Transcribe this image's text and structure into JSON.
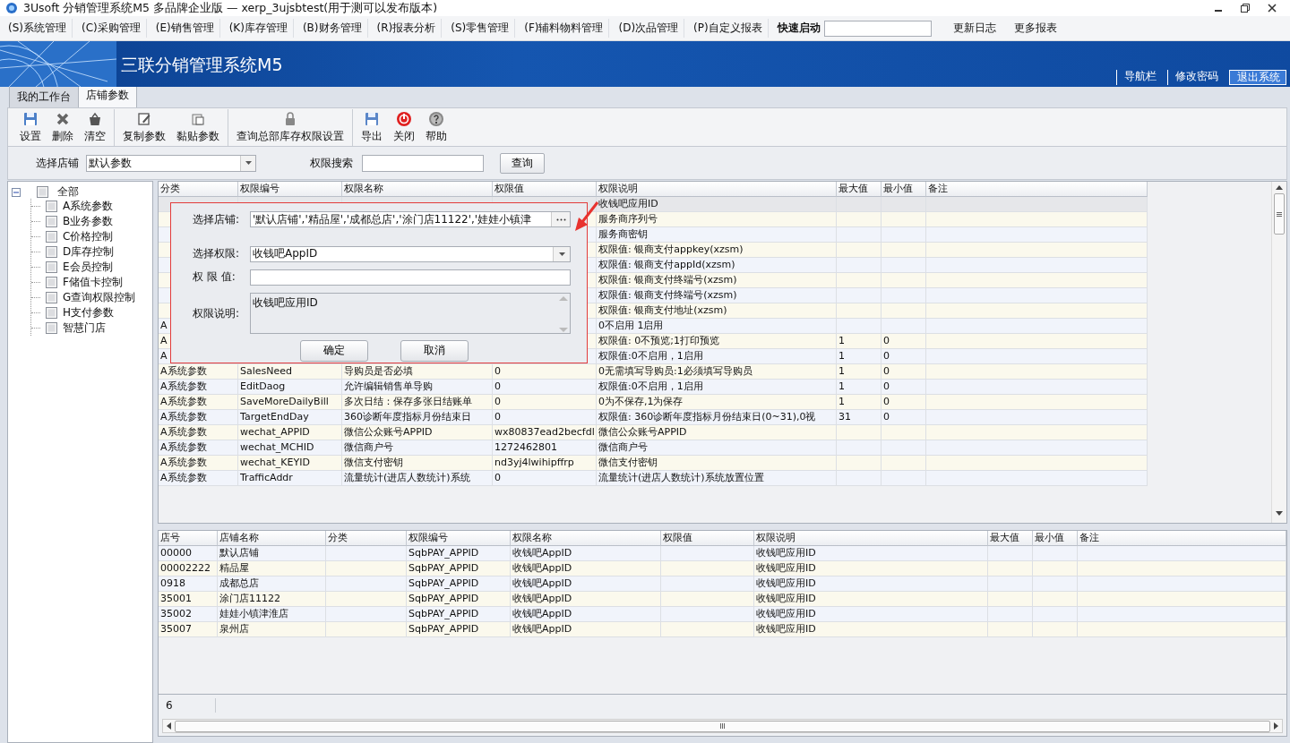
{
  "window": {
    "title": "3Usoft 分销管理系统M5 多品牌企业版 — xerp_3ujsbtest(用于测可以发布版本)"
  },
  "menu": {
    "items": [
      {
        "label": "(S)系统管理"
      },
      {
        "label": "(C)采购管理"
      },
      {
        "label": "(E)销售管理"
      },
      {
        "label": "(K)库存管理"
      },
      {
        "label": "(B)财务管理"
      },
      {
        "label": "(R)报表分析"
      },
      {
        "label": "(S)零售管理"
      },
      {
        "label": "(F)辅料物料管理"
      },
      {
        "label": "(D)次品管理"
      },
      {
        "label": "(P)自定义报表"
      }
    ],
    "quick_launch": {
      "label": "快速启动"
    },
    "links": [
      {
        "label": "更新日志"
      },
      {
        "label": "更多报表"
      }
    ]
  },
  "banner": {
    "title": "三联分销管理系统M5",
    "links": [
      {
        "label": "导航栏",
        "selected": false
      },
      {
        "label": "修改密码",
        "selected": false
      },
      {
        "label": "退出系统",
        "selected": true
      }
    ]
  },
  "tabs": [
    {
      "label": "我的工作台",
      "selected": false
    },
    {
      "label": "店铺参数",
      "selected": true
    }
  ],
  "toolbar": [
    [
      {
        "label": "设置",
        "disabled": false
      },
      {
        "label": "删除",
        "disabled": false
      },
      {
        "label": "清空",
        "disabled": false
      }
    ],
    [
      {
        "label": "复制参数",
        "disabled": false
      },
      {
        "label": "黏贴参数",
        "disabled": false
      }
    ],
    [
      {
        "label": "查询总部库存权限设置",
        "disabled": false
      }
    ],
    [
      {
        "label": "导出",
        "disabled": false
      },
      {
        "label": "关闭",
        "disabled": false
      },
      {
        "label": "帮助",
        "disabled": false
      }
    ]
  ],
  "filter": {
    "store_label": "选择店铺",
    "store_value": "默认参数",
    "search_label": "权限搜索",
    "search_button": "查询"
  },
  "tree": {
    "label": "全部",
    "expanded": true,
    "checked": false,
    "children": [
      {
        "label": "A系统参数",
        "checked": false
      },
      {
        "label": "B业务参数",
        "checked": false
      },
      {
        "label": "C价格控制",
        "checked": false
      },
      {
        "label": "D库存控制",
        "checked": false
      },
      {
        "label": "E会员控制",
        "checked": false
      },
      {
        "label": "F储值卡控制",
        "checked": false
      },
      {
        "label": "G查询权限控制",
        "checked": false
      },
      {
        "label": "H支付参数",
        "checked": false
      },
      {
        "label": "智慧门店",
        "checked": false
      }
    ]
  },
  "top_grid": {
    "columns": [
      "分类",
      "权限编号",
      "权限名称",
      "权限值",
      "权限说明",
      "最大值",
      "最小值",
      "备注"
    ],
    "rows": [
      {
        "kind": "under_dialog",
        "selected": true,
        "cells": [
          "收钱吧应用ID"
        ]
      },
      {
        "kind": "under_dialog",
        "selected": false,
        "cells": [
          "服务商序列号"
        ]
      },
      {
        "kind": "under_dialog",
        "selected": false,
        "cells": [
          "服务商密钥"
        ]
      },
      {
        "kind": "under_dialog",
        "selected": false,
        "cells": [
          "权限值: 银商支付appkey(xzsm)"
        ]
      },
      {
        "kind": "under_dialog",
        "selected": false,
        "cells": [
          "权限值: 银商支付appId(xzsm)"
        ]
      },
      {
        "kind": "under_dialog",
        "selected": false,
        "cells": [
          "权限值: 银商支付终端号(xzsm)"
        ]
      },
      {
        "kind": "under_dialog",
        "selected": false,
        "cells": [
          "权限值: 银商支付终端号(xzsm)"
        ]
      },
      {
        "kind": "under_dialog",
        "selected": false,
        "cells": [
          "权限值: 银商支付地址(xzsm)"
        ]
      },
      {
        "kind": "edge",
        "selected": false,
        "cells": [
          "A",
          "0不启用 1启用"
        ]
      },
      {
        "kind": "edge",
        "selected": false,
        "cells": [
          "A",
          "权限值: 0不预览;1打印预览",
          "1",
          "0"
        ]
      },
      {
        "kind": "edge",
        "selected": false,
        "cells": [
          "A",
          "权限值:0不启用，1启用",
          "1",
          "0"
        ]
      },
      {
        "kind": "full",
        "selected": false,
        "cells": [
          "A系统参数",
          "SalesNeed",
          "导购员是否必填",
          "0",
          "0无需填写导购员:1必须填写导购员",
          "1",
          "0"
        ]
      },
      {
        "kind": "full",
        "selected": false,
        "cells": [
          "A系统参数",
          "EditDaog",
          "允许编辑销售单导购",
          "0",
          "权限值:0不启用，1启用",
          "1",
          "0"
        ]
      },
      {
        "kind": "full",
        "selected": false,
        "cells": [
          "A系统参数",
          "SaveMoreDailyBill",
          "多次日结：保存多张日结账单",
          "0",
          "0为不保存,1为保存",
          "1",
          "0"
        ]
      },
      {
        "kind": "full",
        "selected": false,
        "cells": [
          "A系统参数",
          "TargetEndDay",
          "360诊断年度指标月份结束日",
          "0",
          "权限值: 360诊断年度指标月份结束日(0~31),0视",
          "31",
          "0"
        ]
      },
      {
        "kind": "full",
        "selected": false,
        "cells": [
          "A系统参数",
          "wechat_APPID",
          "微信公众账号APPID",
          "wx80837ead2becfdl",
          "微信公众账号APPID"
        ]
      },
      {
        "kind": "full",
        "selected": false,
        "cells": [
          "A系统参数",
          "wechat_MCHID",
          "微信商户号",
          "1272462801",
          "微信商户号"
        ]
      },
      {
        "kind": "full",
        "selected": false,
        "cells": [
          "A系统参数",
          "wechat_KEYID",
          "微信支付密钥",
          "nd3yj4lwihipffrp",
          "微信支付密钥"
        ]
      },
      {
        "kind": "full",
        "selected": false,
        "cells": [
          "A系统参数",
          "TrafficAddr",
          "流量统计(进店人数统计)系统",
          "0",
          "流量统计(进店人数统计)系统放置位置"
        ]
      }
    ]
  },
  "bottom_grid": {
    "columns": [
      "店号",
      "店铺名称",
      "分类",
      "权限编号",
      "权限名称",
      "权限值",
      "权限说明",
      "最大值",
      "最小值",
      "备注"
    ],
    "rows": [
      {
        "kind": "full",
        "selected": false,
        "cells": [
          "00000",
          "默认店铺",
          "",
          "SqbPAY_APPID",
          "收钱吧AppID",
          "",
          "收钱吧应用ID"
        ]
      },
      {
        "kind": "full",
        "selected": false,
        "cells": [
          "00002222",
          "精品屋",
          "",
          "SqbPAY_APPID",
          "收钱吧AppID",
          "",
          "收钱吧应用ID"
        ]
      },
      {
        "kind": "full",
        "selected": false,
        "cells": [
          "0918",
          "成都总店",
          "",
          "SqbPAY_APPID",
          "收钱吧AppID",
          "",
          "收钱吧应用ID"
        ]
      },
      {
        "kind": "full",
        "selected": false,
        "cells": [
          "35001",
          "涂门店11122",
          "",
          "SqbPAY_APPID",
          "收钱吧AppID",
          "",
          "收钱吧应用ID"
        ]
      },
      {
        "kind": "full",
        "selected": false,
        "cells": [
          "35002",
          "娃娃小镇津淮店",
          "",
          "SqbPAY_APPID",
          "收钱吧AppID",
          "",
          "收钱吧应用ID"
        ]
      },
      {
        "kind": "full",
        "selected": false,
        "cells": [
          "35007",
          "泉州店",
          "",
          "SqbPAY_APPID",
          "收钱吧AppID",
          "",
          "收钱吧应用ID"
        ]
      }
    ],
    "count": "6"
  },
  "dialog": {
    "fields": [
      {
        "kind": "picker",
        "label": "选择店铺:",
        "value": "'默认店铺','精品屋','成都总店','涂门店11122','娃娃小镇津"
      },
      {
        "kind": "dropdown",
        "label": "选择权限:",
        "value": "收钱吧AppID"
      },
      {
        "kind": "text",
        "label": "权 限 值:"
      },
      {
        "kind": "memo",
        "label": "权限说明:",
        "value": "收钱吧应用ID"
      }
    ],
    "buttons": [
      {
        "label": "确定"
      },
      {
        "label": "取消"
      }
    ]
  }
}
